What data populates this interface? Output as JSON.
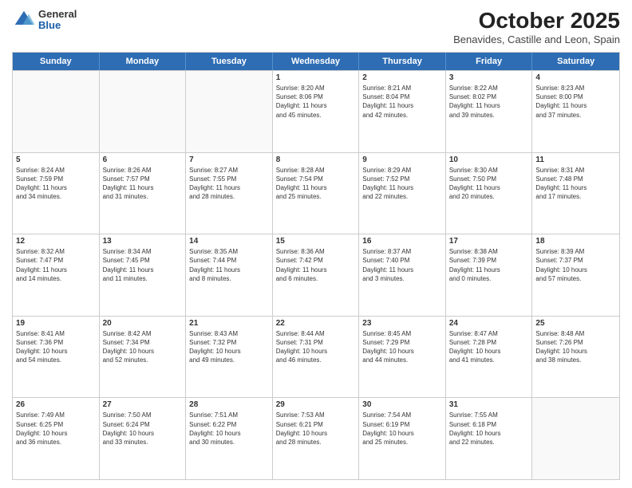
{
  "header": {
    "logo": {
      "general": "General",
      "blue": "Blue"
    },
    "title": "October 2025",
    "subtitle": "Benavides, Castille and Leon, Spain"
  },
  "calendar": {
    "weekdays": [
      "Sunday",
      "Monday",
      "Tuesday",
      "Wednesday",
      "Thursday",
      "Friday",
      "Saturday"
    ],
    "weeks": [
      [
        {
          "day": "",
          "info": ""
        },
        {
          "day": "",
          "info": ""
        },
        {
          "day": "",
          "info": ""
        },
        {
          "day": "1",
          "info": "Sunrise: 8:20 AM\nSunset: 8:06 PM\nDaylight: 11 hours\nand 45 minutes."
        },
        {
          "day": "2",
          "info": "Sunrise: 8:21 AM\nSunset: 8:04 PM\nDaylight: 11 hours\nand 42 minutes."
        },
        {
          "day": "3",
          "info": "Sunrise: 8:22 AM\nSunset: 8:02 PM\nDaylight: 11 hours\nand 39 minutes."
        },
        {
          "day": "4",
          "info": "Sunrise: 8:23 AM\nSunset: 8:00 PM\nDaylight: 11 hours\nand 37 minutes."
        }
      ],
      [
        {
          "day": "5",
          "info": "Sunrise: 8:24 AM\nSunset: 7:59 PM\nDaylight: 11 hours\nand 34 minutes."
        },
        {
          "day": "6",
          "info": "Sunrise: 8:26 AM\nSunset: 7:57 PM\nDaylight: 11 hours\nand 31 minutes."
        },
        {
          "day": "7",
          "info": "Sunrise: 8:27 AM\nSunset: 7:55 PM\nDaylight: 11 hours\nand 28 minutes."
        },
        {
          "day": "8",
          "info": "Sunrise: 8:28 AM\nSunset: 7:54 PM\nDaylight: 11 hours\nand 25 minutes."
        },
        {
          "day": "9",
          "info": "Sunrise: 8:29 AM\nSunset: 7:52 PM\nDaylight: 11 hours\nand 22 minutes."
        },
        {
          "day": "10",
          "info": "Sunrise: 8:30 AM\nSunset: 7:50 PM\nDaylight: 11 hours\nand 20 minutes."
        },
        {
          "day": "11",
          "info": "Sunrise: 8:31 AM\nSunset: 7:48 PM\nDaylight: 11 hours\nand 17 minutes."
        }
      ],
      [
        {
          "day": "12",
          "info": "Sunrise: 8:32 AM\nSunset: 7:47 PM\nDaylight: 11 hours\nand 14 minutes."
        },
        {
          "day": "13",
          "info": "Sunrise: 8:34 AM\nSunset: 7:45 PM\nDaylight: 11 hours\nand 11 minutes."
        },
        {
          "day": "14",
          "info": "Sunrise: 8:35 AM\nSunset: 7:44 PM\nDaylight: 11 hours\nand 8 minutes."
        },
        {
          "day": "15",
          "info": "Sunrise: 8:36 AM\nSunset: 7:42 PM\nDaylight: 11 hours\nand 6 minutes."
        },
        {
          "day": "16",
          "info": "Sunrise: 8:37 AM\nSunset: 7:40 PM\nDaylight: 11 hours\nand 3 minutes."
        },
        {
          "day": "17",
          "info": "Sunrise: 8:38 AM\nSunset: 7:39 PM\nDaylight: 11 hours\nand 0 minutes."
        },
        {
          "day": "18",
          "info": "Sunrise: 8:39 AM\nSunset: 7:37 PM\nDaylight: 10 hours\nand 57 minutes."
        }
      ],
      [
        {
          "day": "19",
          "info": "Sunrise: 8:41 AM\nSunset: 7:36 PM\nDaylight: 10 hours\nand 54 minutes."
        },
        {
          "day": "20",
          "info": "Sunrise: 8:42 AM\nSunset: 7:34 PM\nDaylight: 10 hours\nand 52 minutes."
        },
        {
          "day": "21",
          "info": "Sunrise: 8:43 AM\nSunset: 7:32 PM\nDaylight: 10 hours\nand 49 minutes."
        },
        {
          "day": "22",
          "info": "Sunrise: 8:44 AM\nSunset: 7:31 PM\nDaylight: 10 hours\nand 46 minutes."
        },
        {
          "day": "23",
          "info": "Sunrise: 8:45 AM\nSunset: 7:29 PM\nDaylight: 10 hours\nand 44 minutes."
        },
        {
          "day": "24",
          "info": "Sunrise: 8:47 AM\nSunset: 7:28 PM\nDaylight: 10 hours\nand 41 minutes."
        },
        {
          "day": "25",
          "info": "Sunrise: 8:48 AM\nSunset: 7:26 PM\nDaylight: 10 hours\nand 38 minutes."
        }
      ],
      [
        {
          "day": "26",
          "info": "Sunrise: 7:49 AM\nSunset: 6:25 PM\nDaylight: 10 hours\nand 36 minutes."
        },
        {
          "day": "27",
          "info": "Sunrise: 7:50 AM\nSunset: 6:24 PM\nDaylight: 10 hours\nand 33 minutes."
        },
        {
          "day": "28",
          "info": "Sunrise: 7:51 AM\nSunset: 6:22 PM\nDaylight: 10 hours\nand 30 minutes."
        },
        {
          "day": "29",
          "info": "Sunrise: 7:53 AM\nSunset: 6:21 PM\nDaylight: 10 hours\nand 28 minutes."
        },
        {
          "day": "30",
          "info": "Sunrise: 7:54 AM\nSunset: 6:19 PM\nDaylight: 10 hours\nand 25 minutes."
        },
        {
          "day": "31",
          "info": "Sunrise: 7:55 AM\nSunset: 6:18 PM\nDaylight: 10 hours\nand 22 minutes."
        },
        {
          "day": "",
          "info": ""
        }
      ]
    ]
  }
}
